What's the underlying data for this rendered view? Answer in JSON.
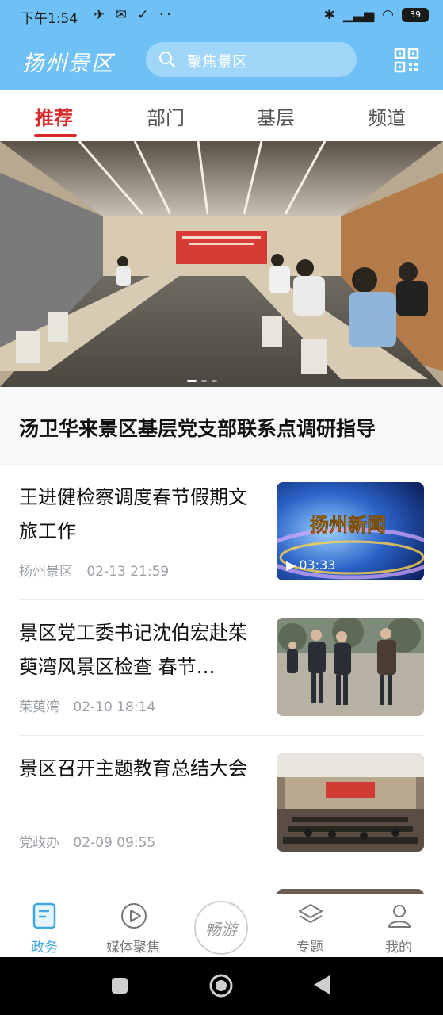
{
  "status_bar": {
    "time": "下午1:54",
    "battery": "39"
  },
  "header": {
    "logo": "扬州景区",
    "search_placeholder": "聚焦景区"
  },
  "tabs": [
    {
      "label": "推荐",
      "active": true
    },
    {
      "label": "部门",
      "active": false
    },
    {
      "label": "基层",
      "active": false
    },
    {
      "label": "频道",
      "active": false
    }
  ],
  "banner": {
    "headline": "汤卫华来景区基层党支部联系点调研指导"
  },
  "news": [
    {
      "title": "王进健检察调度春节假期文旅工作",
      "source": "扬州景区",
      "time": "02-13 21:59",
      "video_duration": "03:33",
      "thumb_text": "扬州新闻"
    },
    {
      "title": "景区党工委书记沈伯宏赴茱萸湾风景区检查 春节…",
      "source": "茱萸湾",
      "time": "02-10 18:14"
    },
    {
      "title": "景区召开主题教育总结大会",
      "source": "党政办",
      "time": "02-09 09:55"
    }
  ],
  "bottom_nav": [
    {
      "label": "政务",
      "active": true
    },
    {
      "label": "媒体聚焦",
      "active": false
    },
    {
      "label": "畅游",
      "active": false
    },
    {
      "label": "专题",
      "active": false
    },
    {
      "label": "我的",
      "active": false
    }
  ],
  "colors": {
    "header_blue": "#6ec0f5",
    "accent_red": "#d7282a",
    "nav_active": "#3fa7e6"
  }
}
